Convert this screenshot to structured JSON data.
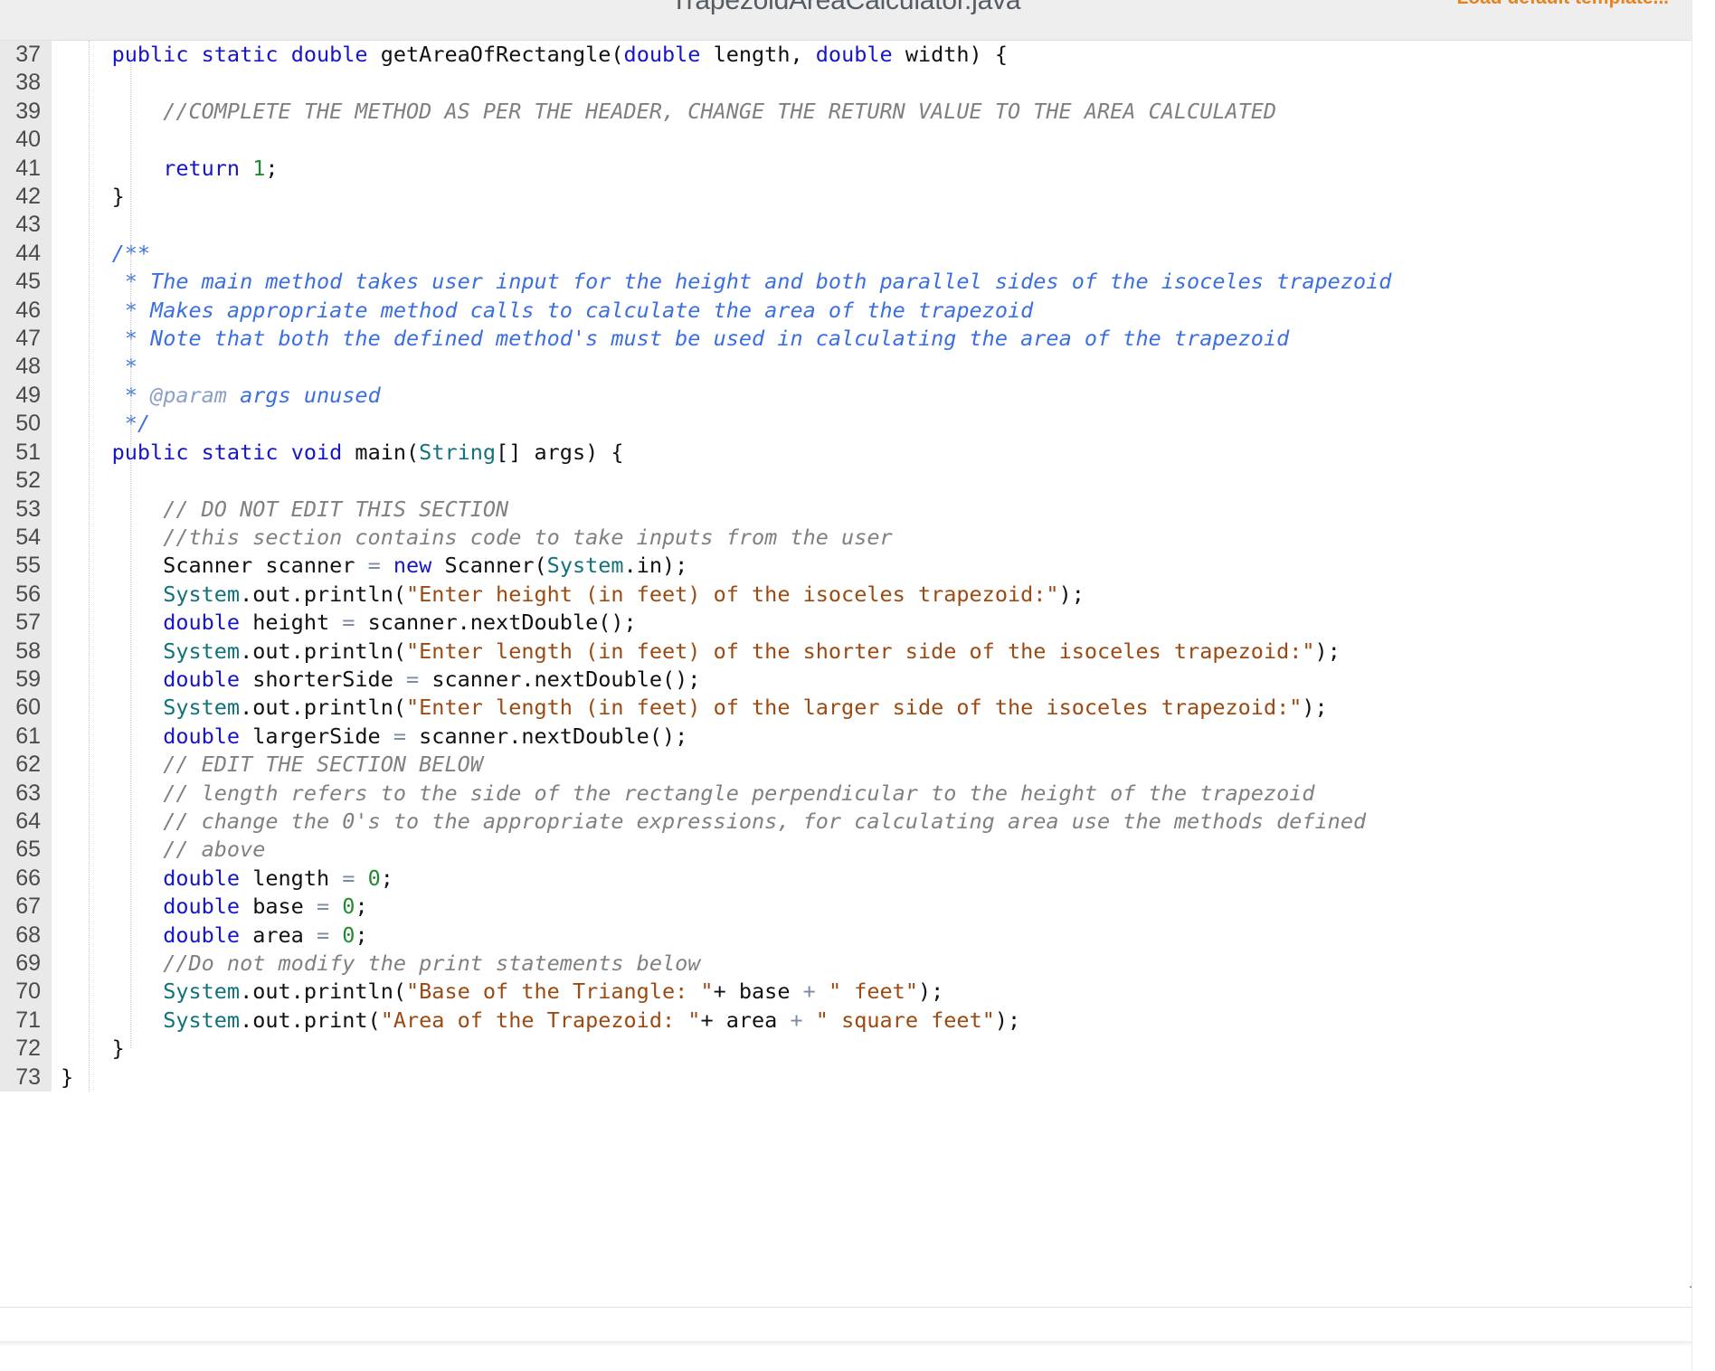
{
  "header": {
    "file_title": "TrapezoidAreaCalculator.java",
    "load_template_label": "Load default template...",
    "accent_color": "#e8821e",
    "title_color": "#555c63"
  },
  "editor": {
    "language": "java",
    "first_visible_line": 37,
    "last_visible_line": 73,
    "theme_colors": {
      "keyword": "#1616c8",
      "type": "#12727a",
      "string": "#9c4a12",
      "number": "#1f8a2e",
      "comment": "#808080",
      "javadoc": "#3b6fe0",
      "javadoc_tag": "#8ba0c4",
      "operator": "#7a8ba3",
      "gutter_bg": "#e9e9e9",
      "gutter_fg": "#4b4b4b",
      "background": "#ffffff"
    },
    "lines": [
      {
        "n": "37",
        "tokens": [
          {
            "t": "    ",
            "c": "plain"
          },
          {
            "t": "public",
            "c": "kw"
          },
          {
            "t": " ",
            "c": "plain"
          },
          {
            "t": "static",
            "c": "kw"
          },
          {
            "t": " ",
            "c": "plain"
          },
          {
            "t": "double",
            "c": "kw"
          },
          {
            "t": " getAreaOfRectangle(",
            "c": "plain"
          },
          {
            "t": "double",
            "c": "kw"
          },
          {
            "t": " length, ",
            "c": "plain"
          },
          {
            "t": "double",
            "c": "kw"
          },
          {
            "t": " width) {",
            "c": "plain"
          }
        ]
      },
      {
        "n": "38",
        "tokens": []
      },
      {
        "n": "39",
        "tokens": [
          {
            "t": "        ",
            "c": "plain"
          },
          {
            "t": "//COMPLETE THE METHOD AS PER THE HEADER, CHANGE THE RETURN VALUE TO THE AREA CALCULATED",
            "c": "cmt"
          }
        ]
      },
      {
        "n": "40",
        "tokens": []
      },
      {
        "n": "41",
        "tokens": [
          {
            "t": "        ",
            "c": "plain"
          },
          {
            "t": "return",
            "c": "kw"
          },
          {
            "t": " ",
            "c": "plain"
          },
          {
            "t": "1",
            "c": "num"
          },
          {
            "t": ";",
            "c": "plain"
          }
        ]
      },
      {
        "n": "42",
        "tokens": [
          {
            "t": "    }",
            "c": "plain"
          }
        ]
      },
      {
        "n": "43",
        "tokens": []
      },
      {
        "n": "44",
        "tokens": [
          {
            "t": "    ",
            "c": "plain"
          },
          {
            "t": "/**",
            "c": "doc"
          }
        ]
      },
      {
        "n": "45",
        "tokens": [
          {
            "t": "     ",
            "c": "plain"
          },
          {
            "t": "* The main method takes user input for the height and both parallel sides of the isoceles trapezoid",
            "c": "doc"
          }
        ]
      },
      {
        "n": "46",
        "tokens": [
          {
            "t": "     ",
            "c": "plain"
          },
          {
            "t": "* Makes appropriate method calls to calculate the area of the trapezoid",
            "c": "doc"
          }
        ]
      },
      {
        "n": "47",
        "tokens": [
          {
            "t": "     ",
            "c": "plain"
          },
          {
            "t": "* Note that both the defined method's must be used in calculating the area of the trapezoid",
            "c": "doc"
          }
        ]
      },
      {
        "n": "48",
        "tokens": [
          {
            "t": "     ",
            "c": "plain"
          },
          {
            "t": "*",
            "c": "doc"
          }
        ]
      },
      {
        "n": "49",
        "tokens": [
          {
            "t": "     ",
            "c": "plain"
          },
          {
            "t": "* ",
            "c": "doc"
          },
          {
            "t": "@param",
            "c": "doctag"
          },
          {
            "t": " args unused",
            "c": "doc"
          }
        ]
      },
      {
        "n": "50",
        "tokens": [
          {
            "t": "     ",
            "c": "plain"
          },
          {
            "t": "*/",
            "c": "doc"
          }
        ]
      },
      {
        "n": "51",
        "tokens": [
          {
            "t": "    ",
            "c": "plain"
          },
          {
            "t": "public",
            "c": "kw"
          },
          {
            "t": " ",
            "c": "plain"
          },
          {
            "t": "static",
            "c": "kw"
          },
          {
            "t": " ",
            "c": "plain"
          },
          {
            "t": "void",
            "c": "kw"
          },
          {
            "t": " main(",
            "c": "plain"
          },
          {
            "t": "String",
            "c": "typ"
          },
          {
            "t": "[] args) {",
            "c": "plain"
          }
        ]
      },
      {
        "n": "52",
        "tokens": []
      },
      {
        "n": "53",
        "tokens": [
          {
            "t": "        ",
            "c": "plain"
          },
          {
            "t": "// DO NOT EDIT THIS SECTION",
            "c": "cmt"
          }
        ]
      },
      {
        "n": "54",
        "tokens": [
          {
            "t": "        ",
            "c": "plain"
          },
          {
            "t": "//this section contains code to take inputs from the user",
            "c": "cmt"
          }
        ]
      },
      {
        "n": "55",
        "tokens": [
          {
            "t": "        Scanner scanner ",
            "c": "plain"
          },
          {
            "t": "=",
            "c": "op"
          },
          {
            "t": " ",
            "c": "plain"
          },
          {
            "t": "new",
            "c": "kw"
          },
          {
            "t": " Scanner(",
            "c": "plain"
          },
          {
            "t": "System",
            "c": "typ"
          },
          {
            "t": ".in);",
            "c": "plain"
          }
        ]
      },
      {
        "n": "56",
        "tokens": [
          {
            "t": "        ",
            "c": "plain"
          },
          {
            "t": "System",
            "c": "typ"
          },
          {
            "t": ".out.println(",
            "c": "plain"
          },
          {
            "t": "\"Enter height (in feet) of the isoceles trapezoid:\"",
            "c": "str"
          },
          {
            "t": ");",
            "c": "plain"
          }
        ]
      },
      {
        "n": "57",
        "tokens": [
          {
            "t": "        ",
            "c": "plain"
          },
          {
            "t": "double",
            "c": "kw"
          },
          {
            "t": " height ",
            "c": "plain"
          },
          {
            "t": "=",
            "c": "op"
          },
          {
            "t": " scanner.nextDouble();",
            "c": "plain"
          }
        ]
      },
      {
        "n": "58",
        "tokens": [
          {
            "t": "        ",
            "c": "plain"
          },
          {
            "t": "System",
            "c": "typ"
          },
          {
            "t": ".out.println(",
            "c": "plain"
          },
          {
            "t": "\"Enter length (in feet) of the shorter side of the isoceles trapezoid:\"",
            "c": "str"
          },
          {
            "t": ");",
            "c": "plain"
          }
        ]
      },
      {
        "n": "59",
        "tokens": [
          {
            "t": "        ",
            "c": "plain"
          },
          {
            "t": "double",
            "c": "kw"
          },
          {
            "t": " shorterSide ",
            "c": "plain"
          },
          {
            "t": "=",
            "c": "op"
          },
          {
            "t": " scanner.nextDouble();",
            "c": "plain"
          }
        ]
      },
      {
        "n": "60",
        "tokens": [
          {
            "t": "        ",
            "c": "plain"
          },
          {
            "t": "System",
            "c": "typ"
          },
          {
            "t": ".out.println(",
            "c": "plain"
          },
          {
            "t": "\"Enter length (in feet) of the larger side of the isoceles trapezoid:\"",
            "c": "str"
          },
          {
            "t": ");",
            "c": "plain"
          }
        ]
      },
      {
        "n": "61",
        "tokens": [
          {
            "t": "        ",
            "c": "plain"
          },
          {
            "t": "double",
            "c": "kw"
          },
          {
            "t": " largerSide ",
            "c": "plain"
          },
          {
            "t": "=",
            "c": "op"
          },
          {
            "t": " scanner.nextDouble();",
            "c": "plain"
          }
        ]
      },
      {
        "n": "62",
        "tokens": [
          {
            "t": "        ",
            "c": "plain"
          },
          {
            "t": "// EDIT THE SECTION BELOW",
            "c": "cmt"
          }
        ]
      },
      {
        "n": "63",
        "tokens": [
          {
            "t": "        ",
            "c": "plain"
          },
          {
            "t": "// length refers to the side of the rectangle perpendicular to the height of the trapezoid",
            "c": "cmt"
          }
        ]
      },
      {
        "n": "64",
        "tokens": [
          {
            "t": "        ",
            "c": "plain"
          },
          {
            "t": "// change the 0's to the appropriate expressions, for calculating area use the methods defined",
            "c": "cmt"
          }
        ]
      },
      {
        "n": "65",
        "tokens": [
          {
            "t": "        ",
            "c": "plain"
          },
          {
            "t": "// above",
            "c": "cmt"
          }
        ]
      },
      {
        "n": "66",
        "tokens": [
          {
            "t": "        ",
            "c": "plain"
          },
          {
            "t": "double",
            "c": "kw"
          },
          {
            "t": " length ",
            "c": "plain"
          },
          {
            "t": "=",
            "c": "op"
          },
          {
            "t": " ",
            "c": "plain"
          },
          {
            "t": "0",
            "c": "num"
          },
          {
            "t": ";",
            "c": "plain"
          }
        ]
      },
      {
        "n": "67",
        "tokens": [
          {
            "t": "        ",
            "c": "plain"
          },
          {
            "t": "double",
            "c": "kw"
          },
          {
            "t": " base ",
            "c": "plain"
          },
          {
            "t": "=",
            "c": "op"
          },
          {
            "t": " ",
            "c": "plain"
          },
          {
            "t": "0",
            "c": "num"
          },
          {
            "t": ";",
            "c": "plain"
          }
        ]
      },
      {
        "n": "68",
        "tokens": [
          {
            "t": "        ",
            "c": "plain"
          },
          {
            "t": "double",
            "c": "kw"
          },
          {
            "t": " area ",
            "c": "plain"
          },
          {
            "t": "=",
            "c": "op"
          },
          {
            "t": " ",
            "c": "plain"
          },
          {
            "t": "0",
            "c": "num"
          },
          {
            "t": ";",
            "c": "plain"
          }
        ]
      },
      {
        "n": "69",
        "tokens": [
          {
            "t": "        ",
            "c": "plain"
          },
          {
            "t": "//Do not modify the print statements below",
            "c": "cmt"
          }
        ]
      },
      {
        "n": "70",
        "tokens": [
          {
            "t": "        ",
            "c": "plain"
          },
          {
            "t": "System",
            "c": "typ"
          },
          {
            "t": ".out.println(",
            "c": "plain"
          },
          {
            "t": "\"Base of the Triangle: \"",
            "c": "str"
          },
          {
            "t": "+ base ",
            "c": "plain"
          },
          {
            "t": "+",
            "c": "op"
          },
          {
            "t": " ",
            "c": "plain"
          },
          {
            "t": "\" feet\"",
            "c": "str"
          },
          {
            "t": ");",
            "c": "plain"
          }
        ]
      },
      {
        "n": "71",
        "tokens": [
          {
            "t": "        ",
            "c": "plain"
          },
          {
            "t": "System",
            "c": "typ"
          },
          {
            "t": ".out.print(",
            "c": "plain"
          },
          {
            "t": "\"Area of the Trapezoid: \"",
            "c": "str"
          },
          {
            "t": "+ area ",
            "c": "plain"
          },
          {
            "t": "+",
            "c": "op"
          },
          {
            "t": " ",
            "c": "plain"
          },
          {
            "t": "\" square feet\"",
            "c": "str"
          },
          {
            "t": ");",
            "c": "plain"
          }
        ]
      },
      {
        "n": "72",
        "tokens": [
          {
            "t": "    }",
            "c": "plain"
          }
        ]
      },
      {
        "n": "73",
        "tokens": [
          {
            "t": "}",
            "c": "plain"
          }
        ]
      }
    ],
    "indent_guides_x": [
      98,
      144
    ],
    "resize_grip": "resize-grip-icon"
  }
}
